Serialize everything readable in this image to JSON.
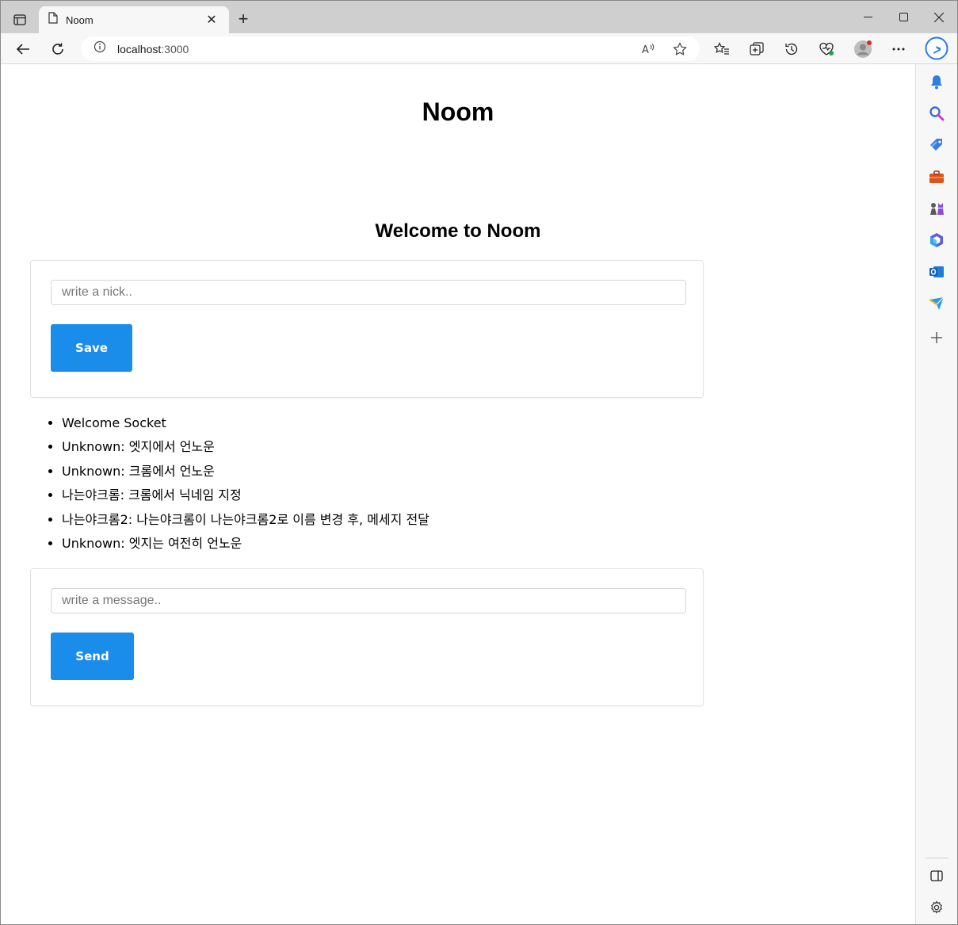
{
  "browser": {
    "tab_title": "Noom",
    "address_host": "localhost",
    "address_port": ":3000"
  },
  "page": {
    "title": "Noom",
    "welcome": "Welcome to Noom",
    "nick_form": {
      "placeholder": "write a nick..",
      "value": "",
      "button_label": "Save"
    },
    "messages": [
      "Welcome Socket",
      "Unknown: 엣지에서 언노운",
      "Unknown: 크롬에서 언노운",
      "나는야크롬: 크롬에서 닉네임 지정",
      "나는야크롬2: 나는야크롬이 나는야크롬2로 이름 변경 후, 메세지 전달",
      "Unknown: 엣지는 여전히 언노운"
    ],
    "message_form": {
      "placeholder": "write a message..",
      "value": "",
      "button_label": "Send"
    }
  },
  "colors": {
    "accent": "#1a8cea",
    "tabstrip": "#cfcfcf",
    "toolbar": "#f7f7f7"
  },
  "sidebar_icons": [
    "bell-icon",
    "search-icon",
    "shopping-tag-icon",
    "tools-icon",
    "games-icon",
    "office-icon",
    "outlook-icon",
    "send-icon",
    "add-icon",
    "sidebar-toggle-icon",
    "settings-icon"
  ]
}
